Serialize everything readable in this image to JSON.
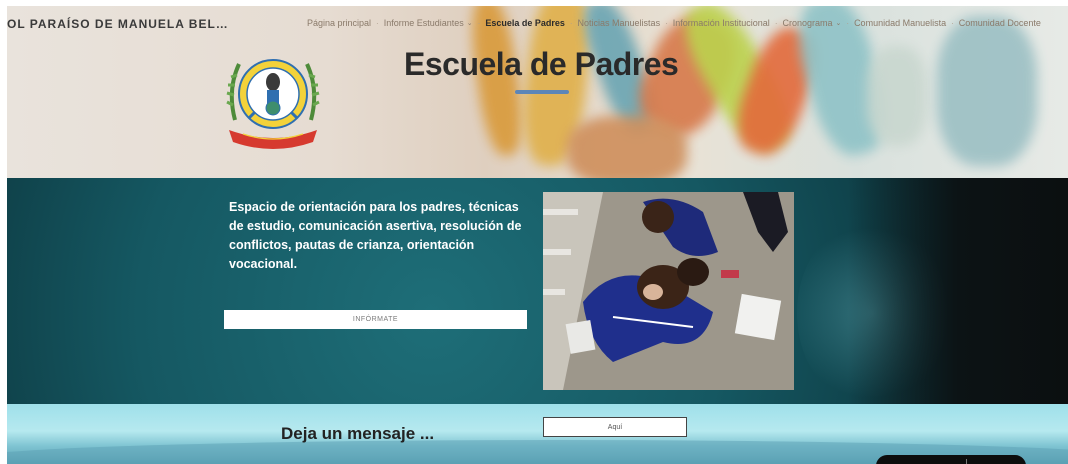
{
  "header": {
    "site_name": "OL PARAÍSO DE MANUELA BEL…",
    "nav": [
      {
        "label": "Página principal",
        "dropdown": false,
        "active": false
      },
      {
        "label": "Informe Estudiantes",
        "dropdown": true,
        "active": false
      },
      {
        "label": "Escuela de Padres",
        "dropdown": false,
        "active": true
      },
      {
        "label": "Noticias Manuelistas",
        "dropdown": false,
        "active": false
      },
      {
        "label": "Información Institucional",
        "dropdown": false,
        "active": false
      },
      {
        "label": "Cronograma",
        "dropdown": true,
        "active": false
      },
      {
        "label": "Comunidad Manuelista",
        "dropdown": false,
        "active": false
      },
      {
        "label": "Comunidad Docente",
        "dropdown": false,
        "active": false
      }
    ]
  },
  "hero": {
    "title": "Escuela de Padres",
    "accent_color": "#5c86b8"
  },
  "main": {
    "description": "Espacio de orientación para los padres, técnicas de estudio, comunicación asertiva, resolución de conflictos, pautas de crianza, orientación vocacional.",
    "info_button": "INFÓRMATE",
    "band_color": "#155862"
  },
  "footer_section": {
    "heading": "Deja un mensaje ...",
    "button": "Aquí"
  },
  "icons": {
    "dropdown": "chevron-down-icon",
    "logo": "school-crest-logo"
  }
}
